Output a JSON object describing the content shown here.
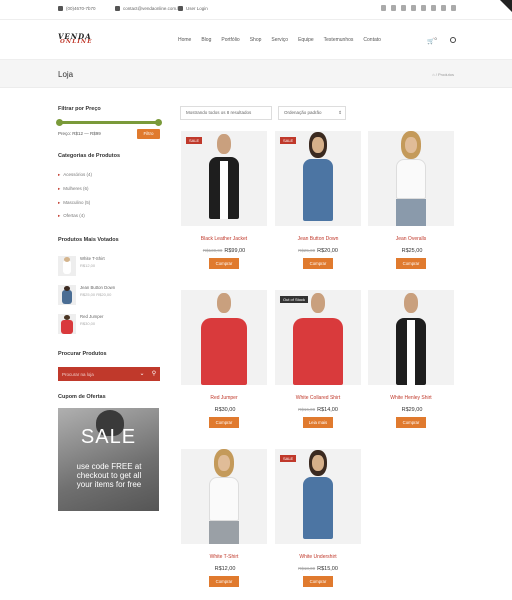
{
  "topbar": {
    "phone": "(00)4670-7b70",
    "email": "contact@vendaonline.com.br",
    "login": "User Login"
  },
  "logo": {
    "line1": "VENDA",
    "line2": "ONLINE"
  },
  "nav": [
    "Home",
    "Blog",
    "Portfólio",
    "Shop",
    "Serviço",
    "Equipe",
    "Testemunhos",
    "Contato"
  ],
  "cart_count": "0",
  "page": {
    "title": "Loja",
    "breadcrumb": "⌂ / Produtos"
  },
  "sidebar": {
    "filter_title": "Filtrar por Preço",
    "price_label": "Preço: R$12 — R$99",
    "filter_button": "Filtro",
    "categories_title": "Categorias de Produtos",
    "categories": [
      "Acessórios (4)",
      "Mulheres (6)",
      "Masculino (5)",
      "Ofertas (4)"
    ],
    "top_title": "Produtos Mais Votados",
    "top": [
      {
        "name": "White T-Shirt",
        "price": "R$12,00"
      },
      {
        "name": "Jean Button Down",
        "price": "R$25,00 R$20,00"
      },
      {
        "name": "Red Jumper",
        "price": "R$30,00"
      }
    ],
    "search_title": "Procurar Produtos",
    "search_placeholder": "Procurar na loja",
    "coupon_title": "Cupom de Ofertas",
    "promo_big": "SALE",
    "promo_small": "use code FREE at checkout to get all your items for free"
  },
  "toolbar": {
    "result": "Mostrando todos os 8 resultados",
    "sort": "Ordenação padrão"
  },
  "products": [
    {
      "name": "Black Leather Jacket",
      "old": "R$130,00",
      "price": "R$99,00",
      "button": "Comprar",
      "badge": "SALE"
    },
    {
      "name": "Jean Button Down",
      "old": "R$25,00",
      "price": "R$20,00",
      "button": "Comprar",
      "badge": "SALE"
    },
    {
      "name": "Jean Overalls",
      "old": "",
      "price": "R$25,00",
      "button": "Comprar",
      "badge": ""
    },
    {
      "name": "Red Jumper",
      "old": "",
      "price": "R$30,00",
      "button": "Comprar",
      "badge": ""
    },
    {
      "name": "White Collared Shirt",
      "old": "R$16,00",
      "price": "R$14,00",
      "button": "Leia mais",
      "badge": "Out of Stock"
    },
    {
      "name": "White Henley Shirt",
      "old": "",
      "price": "R$29,00",
      "button": "Comprar",
      "badge": ""
    },
    {
      "name": "White T-Shirt",
      "old": "",
      "price": "R$12,00",
      "button": "Comprar",
      "badge": ""
    },
    {
      "name": "White Undershirt",
      "old": "R$18,00",
      "price": "R$15,00",
      "button": "Comprar",
      "badge": "SALE"
    }
  ],
  "colors": {
    "accent": "#c0392b",
    "button": "#e07a2e",
    "slider": "#7a9a3a"
  }
}
